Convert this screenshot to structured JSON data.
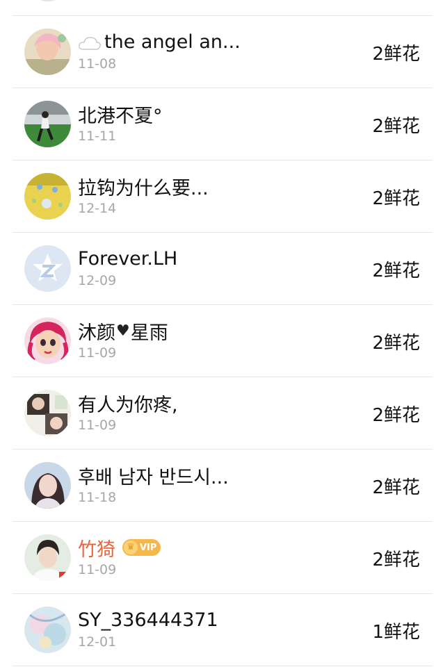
{
  "list": {
    "rows": [
      {
        "name": "the angel an...",
        "date": "11-08",
        "flowers": "2鲜花",
        "avatar_icon": "avatar-anime-girl",
        "prefix_icon": "cloud-icon"
      },
      {
        "name": "北港不夏°",
        "date": "11-11",
        "flowers": "2鲜花",
        "avatar_icon": "avatar-person-on-grass"
      },
      {
        "name": "拉钩为什么要...",
        "date": "12-14",
        "flowers": "2鲜花",
        "avatar_icon": "avatar-yellow-game"
      },
      {
        "name": "Forever.LH",
        "date": "12-09",
        "flowers": "2鲜花",
        "avatar_icon": "avatar-default-qzone"
      },
      {
        "name_part1": "沐颜",
        "name_part2": "星雨",
        "date": "11-09",
        "flowers": "2鲜花",
        "avatar_icon": "avatar-cartoon-girl",
        "inline_icon": "heart-icon"
      },
      {
        "name": "有人为你疼,",
        "date": "11-09",
        "flowers": "2鲜花",
        "avatar_icon": "avatar-two-photos"
      },
      {
        "name": "후배 남자 반드시...",
        "date": "11-18",
        "flowers": "2鲜花",
        "avatar_icon": "avatar-girl-portrait"
      },
      {
        "name": "竹猗",
        "date": "11-09",
        "flowers": "2鲜花",
        "avatar_icon": "avatar-boy-portrait",
        "badge": "VIP",
        "name_color": "#e8643a"
      },
      {
        "name": "SY_336444371",
        "date": "12-01",
        "flowers": "1鲜花",
        "avatar_icon": "avatar-pastel-art"
      }
    ]
  },
  "colors": {
    "name": "#111111",
    "date": "#a7a7ab",
    "divider": "#e3e3e6",
    "vip_name": "#e8643a",
    "vip_badge": "#f6b74a"
  }
}
